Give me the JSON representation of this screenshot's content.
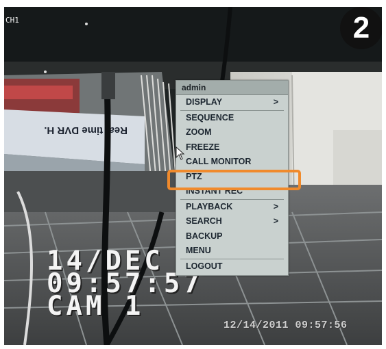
{
  "screen": {
    "channel_label": "CH1",
    "step_number": "2"
  },
  "device_label": "Real time DVR H.",
  "osd": {
    "date": "14/DEC",
    "time": "09:57:57",
    "camera": "CAM 1"
  },
  "timestamp": "12/14/2011 09:57:56",
  "menu": {
    "user": "admin",
    "items": [
      {
        "label": "DISPLAY",
        "arrow": ">"
      },
      {
        "label": "SEQUENCE"
      },
      {
        "label": "ZOOM"
      },
      {
        "label": "FREEZE"
      },
      {
        "label": "CALL MONITOR"
      },
      {
        "label": "PTZ",
        "highlighted": true
      },
      {
        "label": "INSTANT REC"
      },
      {
        "label": "PLAYBACK",
        "arrow": ">"
      },
      {
        "label": "SEARCH",
        "arrow": ">"
      },
      {
        "label": "BACKUP"
      },
      {
        "label": "MENU"
      },
      {
        "label": "LOGOUT"
      }
    ]
  },
  "colors": {
    "highlight": "#f08a2c",
    "menu_bg": "#c9d1cf",
    "badge_bg": "#111111"
  }
}
